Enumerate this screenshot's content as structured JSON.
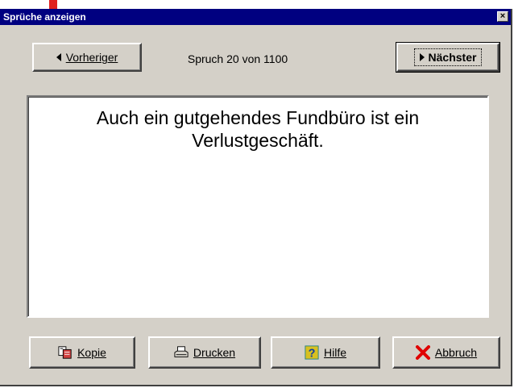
{
  "window": {
    "title": "Sprüche anzeigen",
    "close_label": "×"
  },
  "nav": {
    "prev_label": "Vorheriger",
    "counter_text": "Spruch 20 von 1100",
    "next_label": "Nächster"
  },
  "quote": {
    "text": "Auch ein gutgehendes Fundbüro ist ein Verlustgeschäft."
  },
  "footer": {
    "copy_label": "Kopie",
    "print_label": "Drucken",
    "help_label": "Hilfe",
    "cancel_label": "Abbruch"
  },
  "icons": {
    "prev": "triangle-left-icon",
    "next": "triangle-right-icon",
    "copy": "copy-icon",
    "print": "printer-icon",
    "help": "help-icon",
    "cancel": "x-cancel-icon"
  },
  "colors": {
    "titlebar": "#000080",
    "cancel_x": "#e00000",
    "help_bg": "#d8c020"
  }
}
